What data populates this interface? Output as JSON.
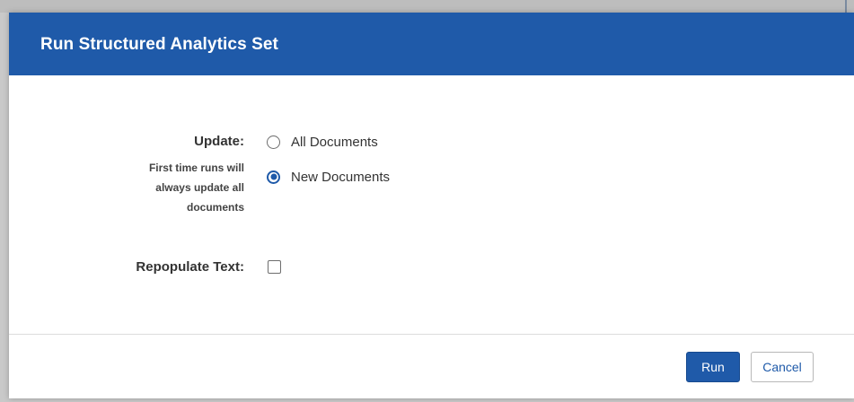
{
  "dialog": {
    "title": "Run Structured Analytics Set"
  },
  "form": {
    "update_label": "Update:",
    "update_note": [
      "First time runs will",
      "always update all",
      "documents"
    ],
    "update_options": [
      {
        "label": "All Documents",
        "checked": false
      },
      {
        "label": "New Documents",
        "checked": true
      }
    ],
    "repopulate_label": "Repopulate Text:",
    "repopulate_checked": false
  },
  "footer": {
    "run_label": "Run",
    "cancel_label": "Cancel"
  },
  "colors": {
    "header": "#1f5aa9",
    "primary_button": "#1f5aa9",
    "backdrop": "#c9c9c9"
  }
}
